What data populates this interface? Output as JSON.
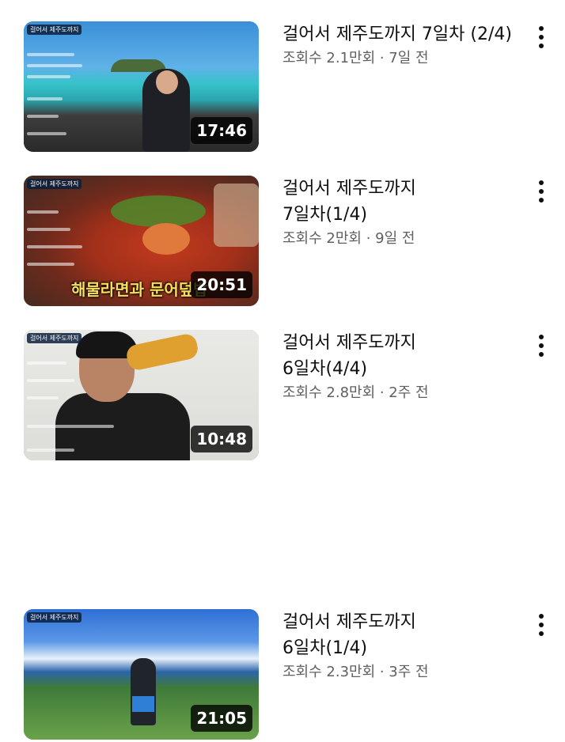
{
  "videos": [
    {
      "title": "걸어서 제주도까지 7일차 (2/4)",
      "meta": "조회수 2.1만회 · 7일 전",
      "duration": "17:46",
      "badge": "걸어서 제주도까지"
    },
    {
      "title": "걸어서 제주도까지 7일차(1/4)",
      "meta": "조회수 2만회 · 9일 전",
      "duration": "20:51",
      "badge": "걸어서 제주도까지",
      "caption": "해물라면과 문어덮밥"
    },
    {
      "title": "걸어서 제주도까지 6일차(4/4)",
      "meta": "조회수 2.8만회 · 2주 전",
      "duration": "10:48",
      "badge": "걸어서 제주도까지"
    },
    {
      "title": "걸어서 제주도까지 6일차(1/4)",
      "meta": "조회수 2.3만회 · 3주 전",
      "duration": "21:05",
      "badge": "걸어서 제주도까지"
    }
  ],
  "icons": {
    "more": "more-vertical-icon"
  },
  "colors": {
    "title": "#0f0f0f",
    "meta": "#606060",
    "duration_bg": "#000000"
  }
}
